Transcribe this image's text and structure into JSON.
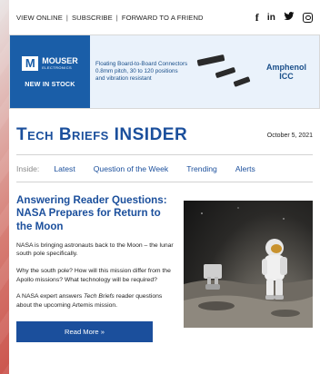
{
  "topbar": {
    "view_online": "VIEW ONLINE",
    "subscribe": "SUBSCRIBE",
    "forward": "FORWARD TO A FRIEND",
    "separator": "|",
    "social": {
      "facebook": "f",
      "linkedin": "in",
      "twitter": "♥"
    }
  },
  "banner": {
    "mouser_name": "MOUSER",
    "mouser_sub": "ELECTRONICS",
    "mouser_mark": "M",
    "in_stock": "NEW IN STOCK",
    "product_text": "Floating Board-to-Board Connectors 0.8mm pitch, 30 to 120 positions and vibration resistant",
    "brand_line1": "Amphenol",
    "brand_line2": "ICC"
  },
  "masthead": {
    "title": "Tech Briefs INSIDER",
    "date": "October 5, 2021"
  },
  "nav": {
    "inside_label": "Inside:",
    "items": [
      "Latest",
      "Question of the Week",
      "Trending",
      "Alerts"
    ]
  },
  "article": {
    "headline": "Answering Reader Questions: NASA Prepares for Return to the Moon",
    "para1": "NASA is bringing astronauts back to the Moon – the lunar south pole specifically.",
    "para2": "Why the south pole? How will this mission differ from the Apollo missions? What technology will be required?",
    "para3_pre": "A NASA expert answers ",
    "para3_em": "Tech Briefs",
    "para3_post": " reader questions about the upcoming Artemis mission.",
    "read_more": "Read More »"
  },
  "colors": {
    "brand_blue": "#1b4f9c",
    "mouser_blue": "#1a5ea8",
    "banner_bg": "#eaf2fb"
  }
}
